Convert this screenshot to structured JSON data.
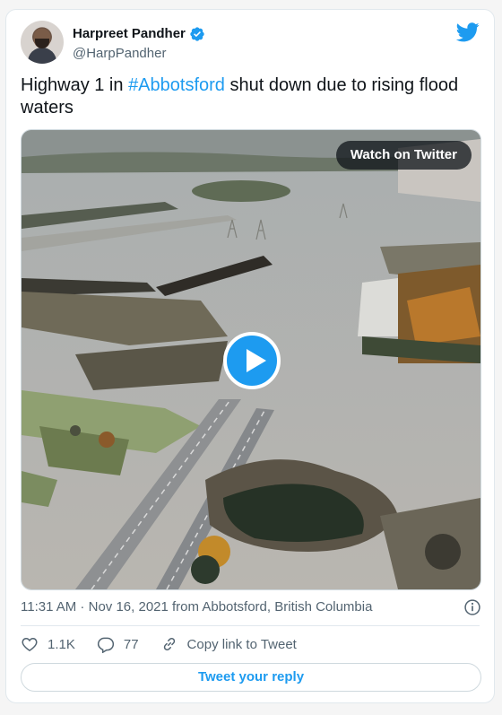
{
  "author": {
    "display_name": "Harpreet Pandher",
    "handle": "@HarpPandher",
    "verified": true
  },
  "tweet": {
    "text_before": "Highway 1 in ",
    "hashtag": "#Abbotsford",
    "text_after": " shut down due to rising flood waters"
  },
  "media": {
    "watch_label": "Watch on Twitter",
    "type": "video"
  },
  "meta": {
    "time": "11:31 AM",
    "separator": " · ",
    "date": "Nov 16, 2021",
    "location": " from Abbotsford, British Columbia"
  },
  "actions": {
    "likes": "1.1K",
    "replies": "77",
    "copy_link": "Copy link to Tweet"
  },
  "reply_button": "Tweet your reply",
  "colors": {
    "accent": "#1d9bf0",
    "text": "#0f1419",
    "muted": "#536471"
  },
  "icons": [
    "verified-badge-icon",
    "twitter-bird-icon",
    "play-icon",
    "info-icon",
    "heart-icon",
    "reply-icon",
    "link-icon"
  ]
}
